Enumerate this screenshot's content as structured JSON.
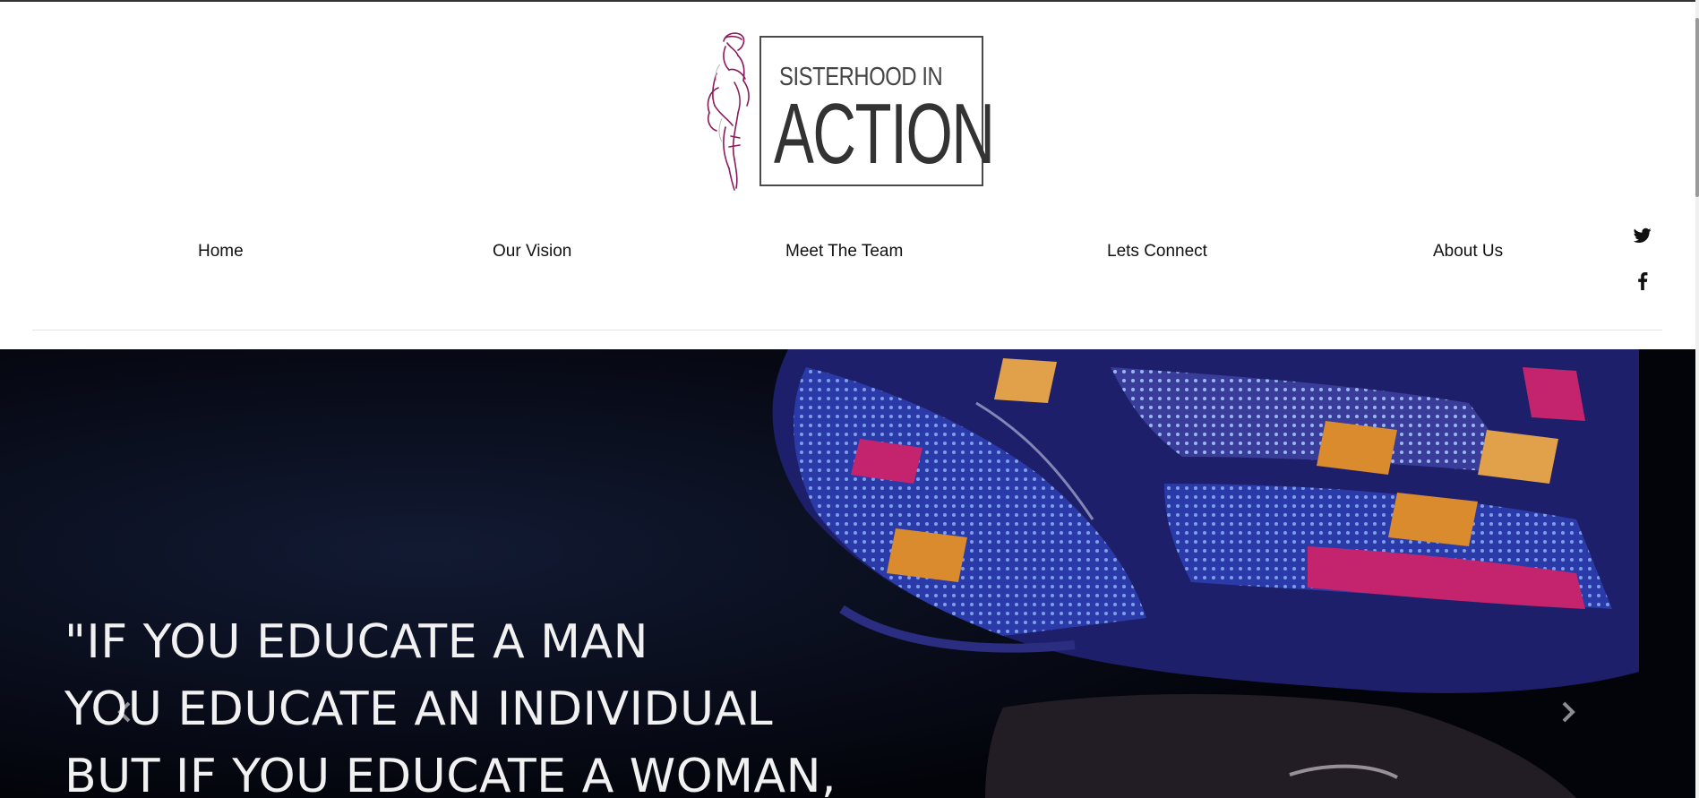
{
  "brand": {
    "line1": "SISTERHOOD IN",
    "line2": "ACTION",
    "accent_color": "#8a1a5c"
  },
  "nav": {
    "items": [
      {
        "label": "Home"
      },
      {
        "label": "Our Vision"
      },
      {
        "label": "Meet The Team"
      },
      {
        "label": "Lets Connect"
      },
      {
        "label": "About Us"
      }
    ]
  },
  "social": {
    "icons": [
      "twitter-icon",
      "facebook-icon"
    ]
  },
  "hero": {
    "quote_lines": [
      "\"IF YOU EDUCATE A MAN",
      "YOU EDUCATE AN INDIVIDUAL",
      "BUT IF YOU EDUCATE A WOMAN,"
    ],
    "prev_icon": "chevron-left-icon",
    "next_icon": "chevron-right-icon"
  }
}
